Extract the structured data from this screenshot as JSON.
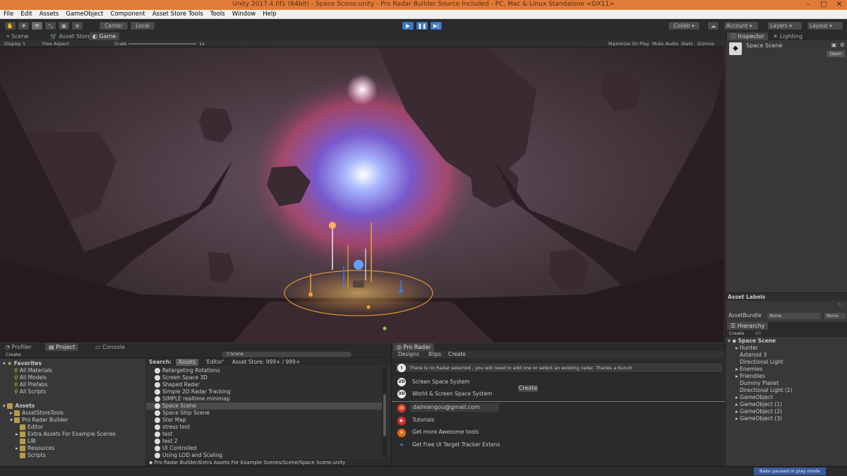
{
  "window": {
    "title": "Unity 2017.4.0f1 (64bit) - Space Scene.unity - Pro Radar Builder Source Included - PC, Mac & Linux Standalone <DX11>"
  },
  "menu": [
    "File",
    "Edit",
    "Assets",
    "GameObject",
    "Component",
    "Asset Store Tools",
    "Tools",
    "Window",
    "Help"
  ],
  "toolbar": {
    "center": "Center",
    "local": "Local",
    "collab": "Collab",
    "account": "Account",
    "layers": "Layers",
    "layout": "Layout"
  },
  "scene_tabs": [
    "Scene",
    "Asset Store",
    "Game"
  ],
  "gamebar": {
    "display": "Display 1",
    "aspect": "Free Aspect",
    "scale_label": "Scale",
    "scale_value": "1x",
    "maximize": "Maximize On Play",
    "mute": "Mute Audio",
    "stats": "Stats",
    "gizmos": "Gizmos"
  },
  "inspector": {
    "tabs": [
      "Inspector",
      "Lighting"
    ],
    "object_name": "Space Scene",
    "open_button": "Open",
    "asset_labels": "Asset Labels",
    "asset_bundle": "AssetBundle",
    "none1": "None",
    "none2": "None"
  },
  "hierarchy": {
    "tab": "Hierarchy",
    "create": "Create",
    "search": "All",
    "scene": "Space Scene",
    "items": [
      "Hunter",
      "Asteroid 3",
      "Directional Light",
      "Enemies",
      "Friendlies",
      "Dummy Planet",
      "Directional Light (1)",
      "GameObject",
      "GameObject (1)",
      "GameObject (2)",
      "GameObject (3)"
    ]
  },
  "bottom_tabs": [
    "Profiler",
    "Project",
    "Console"
  ],
  "project": {
    "create": "Create",
    "search_value": "t:Scene",
    "search_label": "Search:",
    "scope_assets": "Assets",
    "scope_editor": "'Editor'",
    "scope_store": "Asset Store: 999+ / 999+",
    "favorites": "Favorites",
    "fav_items": [
      "All Materials",
      "All Models",
      "All Prefabs",
      "All Scripts"
    ],
    "assets": "Assets",
    "asset_tree": [
      "AssetStoreTools",
      "Pro Radar Builder",
      "Editor",
      "Extra Assets For Example Scenes",
      "LIB",
      "Resources",
      "Scripts"
    ],
    "scenes": [
      "Retargeting Rotations",
      "Screen Space 3D",
      "Shaped Radar",
      "Simple 2D Radar Tracking",
      "SIMPLE realtime minimap",
      "Space Scene",
      "Space Ship Scene",
      "Star Map",
      "stress test",
      "test",
      "test 2",
      "UI Controlled",
      "Using LOD and Scaling"
    ],
    "path": "Pro Radar Builder/Extra Assets For Example Scenes/Scene/Space Scene.unity"
  },
  "radar": {
    "tab": "Pro Radar",
    "tabs": [
      "Designs",
      "Blips",
      "Create"
    ],
    "notice": "There is no Radar selected , you will need to add one or select an existing radar. Thanks a bunch",
    "opt_2d": "Screen Space System",
    "opt_3d": "World & Screen Space System",
    "create_btn": "Create",
    "badge_2d": "2D",
    "badge_3d": "3D",
    "email": "daimangou@gmail.com",
    "tutorials": "Tutorials",
    "more": "Get more Awesome tools",
    "tracker": "Get Free UI Target Tracker Extens"
  },
  "status": {
    "text": "Bake paused in play mode"
  },
  "colors": {
    "title_bar": "#e07b39",
    "selection": "#3e5f96",
    "play": "#3a78c2"
  }
}
